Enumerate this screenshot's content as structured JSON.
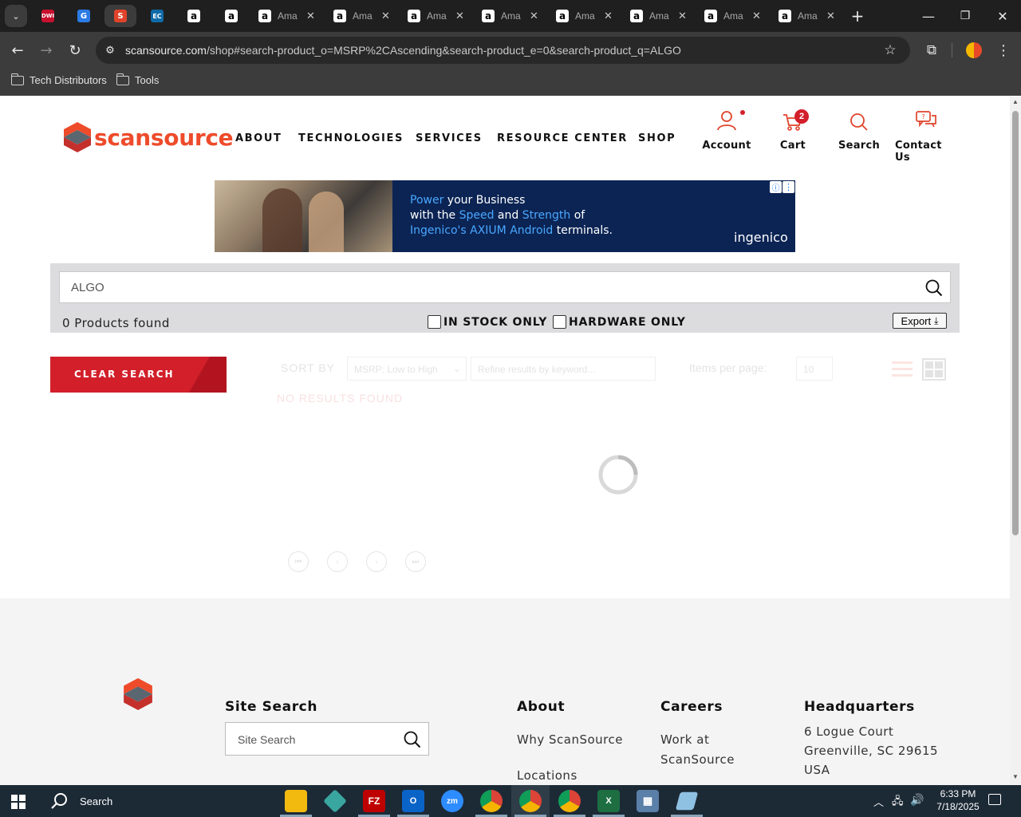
{
  "browser": {
    "tabs": [
      {
        "title": "",
        "favicon": "DWI"
      },
      {
        "title": "",
        "favicon": "G"
      },
      {
        "title": "",
        "favicon": "scansource",
        "active": true
      },
      {
        "title": "",
        "favicon": "EC"
      },
      {
        "title": "",
        "favicon": "a"
      },
      {
        "title": "",
        "favicon": "a"
      },
      {
        "title": "Ama",
        "favicon": "a"
      },
      {
        "title": "Ama",
        "favicon": "a"
      },
      {
        "title": "Ama",
        "favicon": "a"
      },
      {
        "title": "Ama",
        "favicon": "a"
      },
      {
        "title": "Ama",
        "favicon": "a"
      },
      {
        "title": "Ama",
        "favicon": "a"
      },
      {
        "title": "Ama",
        "favicon": "a"
      },
      {
        "title": "Ama",
        "favicon": "a"
      }
    ],
    "url_domain": "scansource.com",
    "url_path": "/shop#search-product_o=MSRP%2CAscending&search-product_e=0&search-product_q=ALGO",
    "bookmarks": [
      "Tech Distributors",
      "Tools"
    ]
  },
  "site": {
    "logo_text": "scansource",
    "nav": [
      "ABOUT",
      "TECHNOLOGIES",
      "SERVICES",
      "RESOURCE CENTER",
      "SHOP"
    ],
    "utils": {
      "account": "Account",
      "cart": "Cart",
      "cart_count": "2",
      "search": "Search",
      "contact": "Contact Us"
    },
    "ad": {
      "line1_hl": "Power",
      "line1": " your Business",
      "line2_a": "with the ",
      "line2_hl1": "Speed",
      "line2_b": " and ",
      "line2_hl2": "Strength",
      "line2_c": " of",
      "line3_hl": "Ingenico's AXIUM Android",
      "line3": " terminals.",
      "brand": "ingenico"
    },
    "search": {
      "value": "ALGO",
      "results_count": "0 Products found",
      "filter_stock": "IN STOCK ONLY",
      "filter_hardware": "HARDWARE ONLY",
      "export": "Export"
    },
    "clear_search": "CLEAR SEARCH",
    "toolbar": {
      "sort_label": "SORT BY",
      "sort_value": "MSRP: Low to High",
      "filter_placeholder": "Refine results by keyword...",
      "items_label": "Items per page:",
      "items_value": "10",
      "no_results": "NO RESULTS FOUND"
    },
    "footer": {
      "site_search_title": "Site Search",
      "site_search_placeholder": "Site Search",
      "about_title": "About",
      "about_links": [
        "Why ScanSource",
        "Locations"
      ],
      "careers_title": "Careers",
      "careers_links": [
        "Work at",
        "ScanSource"
      ],
      "hq_title": "Headquarters",
      "hq_lines": [
        "6 Logue Court",
        "Greenville, SC 29615",
        "USA"
      ]
    }
  },
  "taskbar": {
    "search": "Search",
    "time": "6:33 PM",
    "date": "7/18/2025"
  },
  "colors": {
    "brand_red": "#d21f2a",
    "brand_orange": "#ee4b2b",
    "ad_blue": "#4aa7ff"
  }
}
